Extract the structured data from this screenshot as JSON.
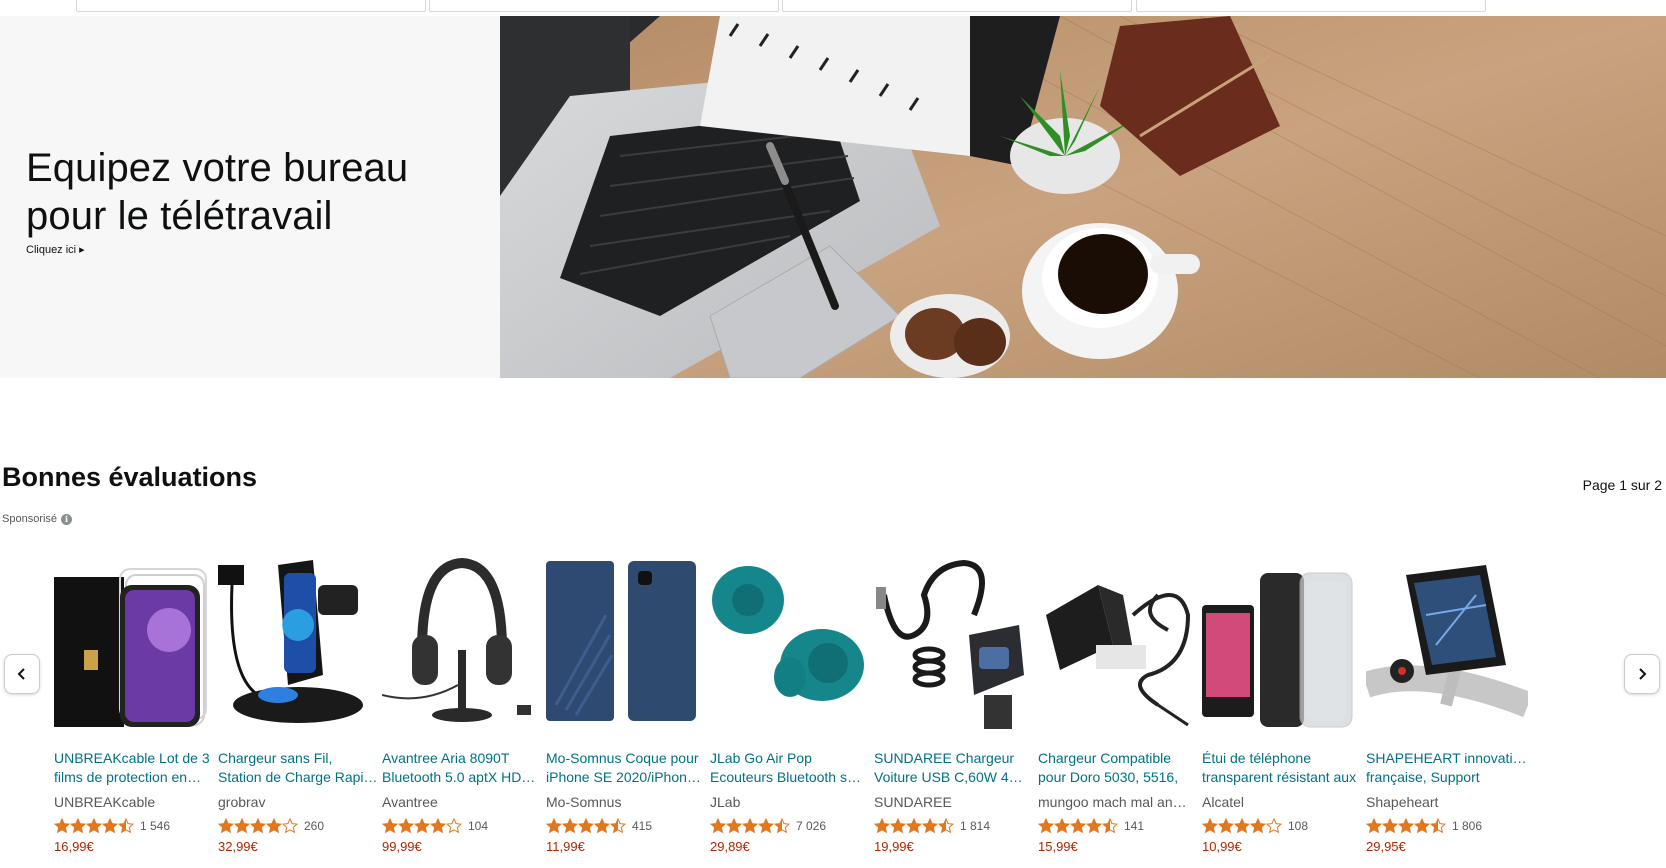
{
  "hero": {
    "title_line1": "Equipez votre bureau",
    "title_line2": "pour le télétravail",
    "link_label": "Cliquez ici ▸"
  },
  "section": {
    "title": "Bonnes évaluations",
    "page_indicator": "Page 1 sur 2",
    "sponsored_label": "Sponsorisé",
    "info_glyph": "i"
  },
  "colors": {
    "link": "#007185",
    "price": "#b12704",
    "star": "#de7921"
  },
  "products": [
    {
      "title_line1": "UNBREAKcable Lot de 3",
      "title_line2": "films de protection en…",
      "brand": "UNBREAKcable",
      "rating": 4.5,
      "reviews": "1 546",
      "price": "16,99€"
    },
    {
      "title_line1": "Chargeur sans Fil,",
      "title_line2": "Station de Charge Rapi…",
      "brand": "grobrav",
      "rating": 4.0,
      "reviews": "260",
      "price": "32,99€"
    },
    {
      "title_line1": "Avantree Aria 8090T",
      "title_line2": "Bluetooth 5.0 aptX HD…",
      "brand": "Avantree",
      "rating": 4.0,
      "reviews": "104",
      "price": "99,99€"
    },
    {
      "title_line1": "Mo-Somnus Coque pour",
      "title_line2": "iPhone SE 2020/iPhon…",
      "brand": "Mo-Somnus",
      "rating": 4.5,
      "reviews": "415",
      "price": "11,99€"
    },
    {
      "title_line1": "JLab Go Air Pop",
      "title_line2": "Ecouteurs Bluetooth s…",
      "brand": "JLab",
      "rating": 4.5,
      "reviews": "7 026",
      "price": "29,89€"
    },
    {
      "title_line1": "SUNDAREE Chargeur",
      "title_line2": "Voiture USB C,60W 4…",
      "brand": "SUNDAREE",
      "rating": 4.5,
      "reviews": "1 814",
      "price": "19,99€"
    },
    {
      "title_line1": "Chargeur Compatible",
      "title_line2": "pour Doro 5030, 5516,",
      "brand": "mungoo mach mal an…",
      "rating": 4.5,
      "reviews": "141",
      "price": "15,99€"
    },
    {
      "title_line1": "Étui de téléphone",
      "title_line2": "transparent résistant aux",
      "brand": "Alcatel",
      "rating": 4.0,
      "reviews": "108",
      "price": "10,99€"
    },
    {
      "title_line1": "SHAPEHEART innovation",
      "title_line2": "française, Support",
      "brand": "Shapeheart",
      "rating": 4.5,
      "reviews": "1 806",
      "price": "29,95€"
    }
  ]
}
